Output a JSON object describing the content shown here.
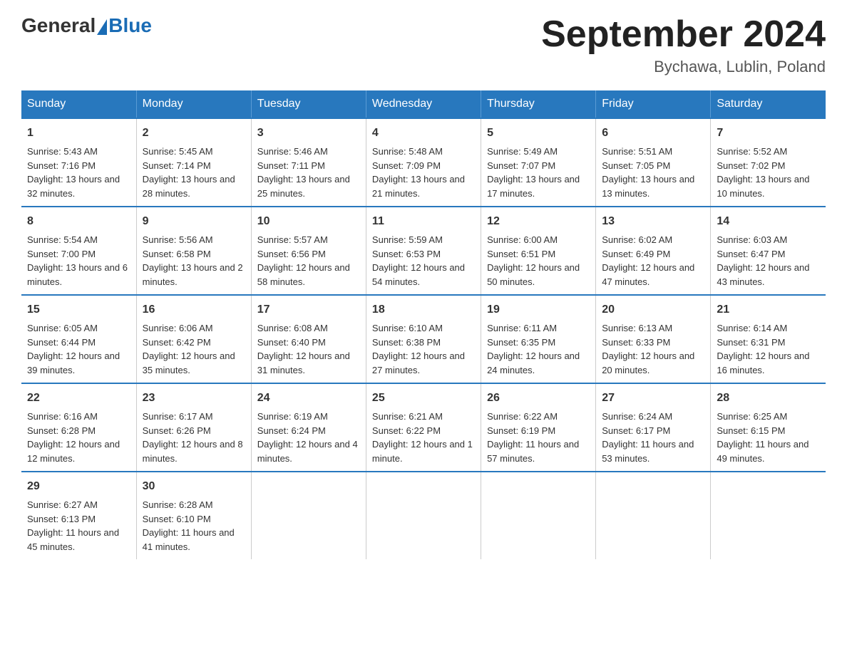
{
  "header": {
    "logo_general": "General",
    "logo_blue": "Blue",
    "month_title": "September 2024",
    "location": "Bychawa, Lublin, Poland"
  },
  "days_of_week": [
    "Sunday",
    "Monday",
    "Tuesday",
    "Wednesday",
    "Thursday",
    "Friday",
    "Saturday"
  ],
  "weeks": [
    [
      {
        "day": "1",
        "sunrise": "Sunrise: 5:43 AM",
        "sunset": "Sunset: 7:16 PM",
        "daylight": "Daylight: 13 hours and 32 minutes."
      },
      {
        "day": "2",
        "sunrise": "Sunrise: 5:45 AM",
        "sunset": "Sunset: 7:14 PM",
        "daylight": "Daylight: 13 hours and 28 minutes."
      },
      {
        "day": "3",
        "sunrise": "Sunrise: 5:46 AM",
        "sunset": "Sunset: 7:11 PM",
        "daylight": "Daylight: 13 hours and 25 minutes."
      },
      {
        "day": "4",
        "sunrise": "Sunrise: 5:48 AM",
        "sunset": "Sunset: 7:09 PM",
        "daylight": "Daylight: 13 hours and 21 minutes."
      },
      {
        "day": "5",
        "sunrise": "Sunrise: 5:49 AM",
        "sunset": "Sunset: 7:07 PM",
        "daylight": "Daylight: 13 hours and 17 minutes."
      },
      {
        "day": "6",
        "sunrise": "Sunrise: 5:51 AM",
        "sunset": "Sunset: 7:05 PM",
        "daylight": "Daylight: 13 hours and 13 minutes."
      },
      {
        "day": "7",
        "sunrise": "Sunrise: 5:52 AM",
        "sunset": "Sunset: 7:02 PM",
        "daylight": "Daylight: 13 hours and 10 minutes."
      }
    ],
    [
      {
        "day": "8",
        "sunrise": "Sunrise: 5:54 AM",
        "sunset": "Sunset: 7:00 PM",
        "daylight": "Daylight: 13 hours and 6 minutes."
      },
      {
        "day": "9",
        "sunrise": "Sunrise: 5:56 AM",
        "sunset": "Sunset: 6:58 PM",
        "daylight": "Daylight: 13 hours and 2 minutes."
      },
      {
        "day": "10",
        "sunrise": "Sunrise: 5:57 AM",
        "sunset": "Sunset: 6:56 PM",
        "daylight": "Daylight: 12 hours and 58 minutes."
      },
      {
        "day": "11",
        "sunrise": "Sunrise: 5:59 AM",
        "sunset": "Sunset: 6:53 PM",
        "daylight": "Daylight: 12 hours and 54 minutes."
      },
      {
        "day": "12",
        "sunrise": "Sunrise: 6:00 AM",
        "sunset": "Sunset: 6:51 PM",
        "daylight": "Daylight: 12 hours and 50 minutes."
      },
      {
        "day": "13",
        "sunrise": "Sunrise: 6:02 AM",
        "sunset": "Sunset: 6:49 PM",
        "daylight": "Daylight: 12 hours and 47 minutes."
      },
      {
        "day": "14",
        "sunrise": "Sunrise: 6:03 AM",
        "sunset": "Sunset: 6:47 PM",
        "daylight": "Daylight: 12 hours and 43 minutes."
      }
    ],
    [
      {
        "day": "15",
        "sunrise": "Sunrise: 6:05 AM",
        "sunset": "Sunset: 6:44 PM",
        "daylight": "Daylight: 12 hours and 39 minutes."
      },
      {
        "day": "16",
        "sunrise": "Sunrise: 6:06 AM",
        "sunset": "Sunset: 6:42 PM",
        "daylight": "Daylight: 12 hours and 35 minutes."
      },
      {
        "day": "17",
        "sunrise": "Sunrise: 6:08 AM",
        "sunset": "Sunset: 6:40 PM",
        "daylight": "Daylight: 12 hours and 31 minutes."
      },
      {
        "day": "18",
        "sunrise": "Sunrise: 6:10 AM",
        "sunset": "Sunset: 6:38 PM",
        "daylight": "Daylight: 12 hours and 27 minutes."
      },
      {
        "day": "19",
        "sunrise": "Sunrise: 6:11 AM",
        "sunset": "Sunset: 6:35 PM",
        "daylight": "Daylight: 12 hours and 24 minutes."
      },
      {
        "day": "20",
        "sunrise": "Sunrise: 6:13 AM",
        "sunset": "Sunset: 6:33 PM",
        "daylight": "Daylight: 12 hours and 20 minutes."
      },
      {
        "day": "21",
        "sunrise": "Sunrise: 6:14 AM",
        "sunset": "Sunset: 6:31 PM",
        "daylight": "Daylight: 12 hours and 16 minutes."
      }
    ],
    [
      {
        "day": "22",
        "sunrise": "Sunrise: 6:16 AM",
        "sunset": "Sunset: 6:28 PM",
        "daylight": "Daylight: 12 hours and 12 minutes."
      },
      {
        "day": "23",
        "sunrise": "Sunrise: 6:17 AM",
        "sunset": "Sunset: 6:26 PM",
        "daylight": "Daylight: 12 hours and 8 minutes."
      },
      {
        "day": "24",
        "sunrise": "Sunrise: 6:19 AM",
        "sunset": "Sunset: 6:24 PM",
        "daylight": "Daylight: 12 hours and 4 minutes."
      },
      {
        "day": "25",
        "sunrise": "Sunrise: 6:21 AM",
        "sunset": "Sunset: 6:22 PM",
        "daylight": "Daylight: 12 hours and 1 minute."
      },
      {
        "day": "26",
        "sunrise": "Sunrise: 6:22 AM",
        "sunset": "Sunset: 6:19 PM",
        "daylight": "Daylight: 11 hours and 57 minutes."
      },
      {
        "day": "27",
        "sunrise": "Sunrise: 6:24 AM",
        "sunset": "Sunset: 6:17 PM",
        "daylight": "Daylight: 11 hours and 53 minutes."
      },
      {
        "day": "28",
        "sunrise": "Sunrise: 6:25 AM",
        "sunset": "Sunset: 6:15 PM",
        "daylight": "Daylight: 11 hours and 49 minutes."
      }
    ],
    [
      {
        "day": "29",
        "sunrise": "Sunrise: 6:27 AM",
        "sunset": "Sunset: 6:13 PM",
        "daylight": "Daylight: 11 hours and 45 minutes."
      },
      {
        "day": "30",
        "sunrise": "Sunrise: 6:28 AM",
        "sunset": "Sunset: 6:10 PM",
        "daylight": "Daylight: 11 hours and 41 minutes."
      },
      {
        "day": "",
        "sunrise": "",
        "sunset": "",
        "daylight": ""
      },
      {
        "day": "",
        "sunrise": "",
        "sunset": "",
        "daylight": ""
      },
      {
        "day": "",
        "sunrise": "",
        "sunset": "",
        "daylight": ""
      },
      {
        "day": "",
        "sunrise": "",
        "sunset": "",
        "daylight": ""
      },
      {
        "day": "",
        "sunrise": "",
        "sunset": "",
        "daylight": ""
      }
    ]
  ]
}
